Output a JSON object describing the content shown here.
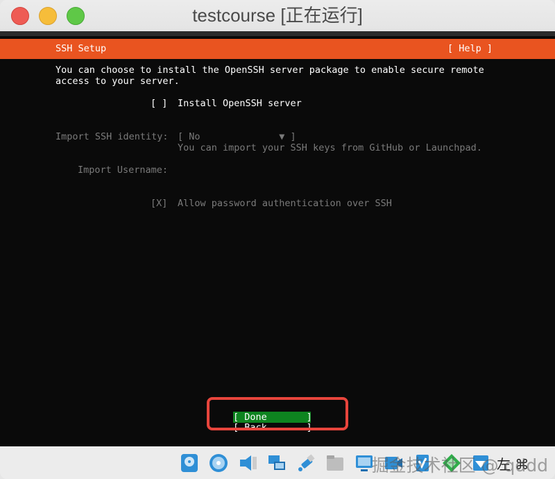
{
  "window": {
    "title": "testcourse [正在运行]"
  },
  "header": {
    "title": "SSH Setup",
    "help": "[ Help ]"
  },
  "intro": {
    "line1": "You can choose to install the OpenSSH server package to enable secure remote",
    "line2": "access to your server."
  },
  "install_openssh": {
    "checkbox": "[ ]",
    "label": "Install OpenSSH server"
  },
  "import_identity": {
    "label": "Import SSH identity:",
    "value": "[ No              ▼ ]",
    "help": "You can import your SSH keys from GitHub or Launchpad."
  },
  "import_username": {
    "label": "Import Username:"
  },
  "allow_password": {
    "checkbox": "[X]",
    "label": "Allow password authentication over SSH"
  },
  "buttons": {
    "done": "[ Done       ]",
    "back": "[ Back       ]"
  },
  "statusbar": {
    "icons": [
      "hard-disk-icon",
      "optical-disc-icon",
      "audio-icon",
      "network-icon",
      "usb-icon",
      "shared-folder-icon",
      "display-icon",
      "recording-icon",
      "cpu-icon",
      "mouse-integration-icon",
      "left-arrow-icon",
      "cmd-icon"
    ],
    "host_key": "左 ⌘",
    "watermark": "掘金技术社区 @ qddd"
  },
  "colors": {
    "accent": "#e95420",
    "done_button": "#0e8420",
    "highlight_border": "#e8453c"
  }
}
